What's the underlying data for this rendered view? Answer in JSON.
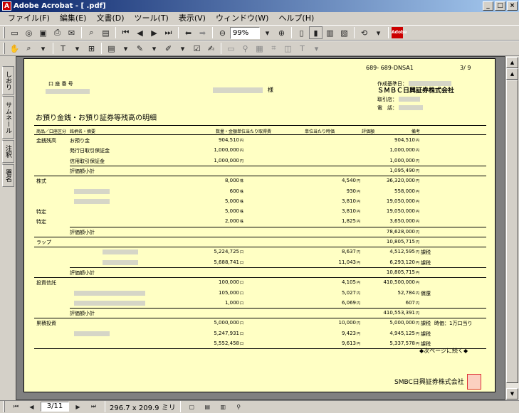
{
  "window": {
    "title": "Adobe Acrobat - [                              .pdf]"
  },
  "menu": [
    "ファイル(F)",
    "編集(E)",
    "文書(D)",
    "ツール(T)",
    "表示(V)",
    "ウィンドウ(W)",
    "ヘルプ(H)"
  ],
  "toolbar": {
    "zoom": "99%"
  },
  "nav_tabs": [
    "しおり",
    "サムネール",
    "注釈",
    "署名"
  ],
  "status": {
    "page": "3/11",
    "size": "296.7 x 209.9 ミリ"
  },
  "doc": {
    "code": "689- 689-DNSA1",
    "page": "3/ 9",
    "account_label": "口 座 番 号",
    "sama": "様",
    "created": "作成基準日：",
    "company": "ＳＭＢＣ日興証券株式会社",
    "branch": "取引店：",
    "phone": "電　話：",
    "heading": "お預り金銭・お預り証券等残高の明細",
    "cols": [
      "商品／口座区分",
      "銘柄名・摘要",
      "数量・金額",
      "単位当たり取得費",
      "単位当たり時価",
      "評価額",
      "備考"
    ],
    "rows": [
      {
        "c0": "金銭残高",
        "c1": "お預り金",
        "qty": "904,510",
        "qu": "円",
        "val": "904,510",
        "vu": "円"
      },
      {
        "c1": "発行日取引保証金",
        "qty": "1,000,000",
        "qu": "円",
        "val": "1,000,000",
        "vu": "円"
      },
      {
        "c1": "信用取引保証金",
        "qty": "1,000,000",
        "qu": "円",
        "val": "1,000,000",
        "vu": "円"
      },
      {
        "c1": "評価額小計",
        "val": "1,095,490",
        "vu": "円"
      },
      {
        "c0": "株式",
        "qty": "8,000",
        "qu": "株",
        "price": "4,540",
        "pu": "円",
        "val": "36,320,000",
        "vu": "円"
      },
      {
        "qty": "600",
        "qu": "株",
        "price": "930",
        "pu": "円",
        "val": "558,000",
        "vu": "円"
      },
      {
        "qty": "5,000",
        "qu": "株",
        "price": "3,810",
        "pu": "円",
        "val": "19,050,000",
        "vu": "円"
      },
      {
        "c0": "特定",
        "qty": "5,000",
        "qu": "株",
        "price": "3,810",
        "pu": "円",
        "val": "19,050,000",
        "vu": "円"
      },
      {
        "c0": "特定",
        "qty": "2,000",
        "qu": "株",
        "price": "1,825",
        "pu": "円",
        "val": "3,650,000",
        "vu": "円"
      },
      {
        "c1": "評価額小計",
        "val": "78,628,000",
        "vu": "円"
      },
      {
        "c0": "ラップ",
        "val": "10,805,715",
        "vu": "円"
      },
      {
        "qty": "5,224,725",
        "qu": "口",
        "price": "8,637",
        "pu": "円",
        "val": "4,512,595",
        "vu": "円",
        "note": "課税"
      },
      {
        "qty": "5,688,741",
        "qu": "口",
        "price": "11,043",
        "pu": "円",
        "val": "6,293,120",
        "vu": "円",
        "note": "課税"
      },
      {
        "c1": "評価額小計",
        "val": "10,805,715",
        "vu": "円"
      },
      {
        "c0": "投資信託",
        "qty": "100,000",
        "qu": "口",
        "price": "4,105",
        "pu": "円",
        "val": "410,500,000",
        "vu": "円"
      },
      {
        "qty": "105,000",
        "qu": "口",
        "price": "5,027",
        "pu": "円",
        "val": "52,784",
        "vu": "円",
        "note": "償還"
      },
      {
        "qty": "1,000",
        "qu": "口",
        "price": "6,069",
        "pu": "円",
        "val": "607",
        "vu": "円"
      },
      {
        "c1": "評価額小計",
        "val": "410,553,391",
        "vu": "円"
      },
      {
        "c0": "累積投資",
        "qty": "5,000,000",
        "qu": "口",
        "price": "10,000",
        "pu": "円",
        "val": "5,000,000",
        "vu": "円",
        "note": "課税",
        "note2": "時価：1万口当り"
      },
      {
        "qty": "5,247,931",
        "qu": "口",
        "price": "9,423",
        "pu": "円",
        "val": "4,945,125",
        "vu": "円",
        "note": "課税"
      },
      {
        "qty": "5,552,458",
        "qu": "口",
        "price": "9,613",
        "pu": "円",
        "val": "5,337,578",
        "vu": "円",
        "note": "課税"
      }
    ],
    "next_page": "◆次ページに続く◆",
    "footer_company": "SMBC日興証券株式会社"
  }
}
